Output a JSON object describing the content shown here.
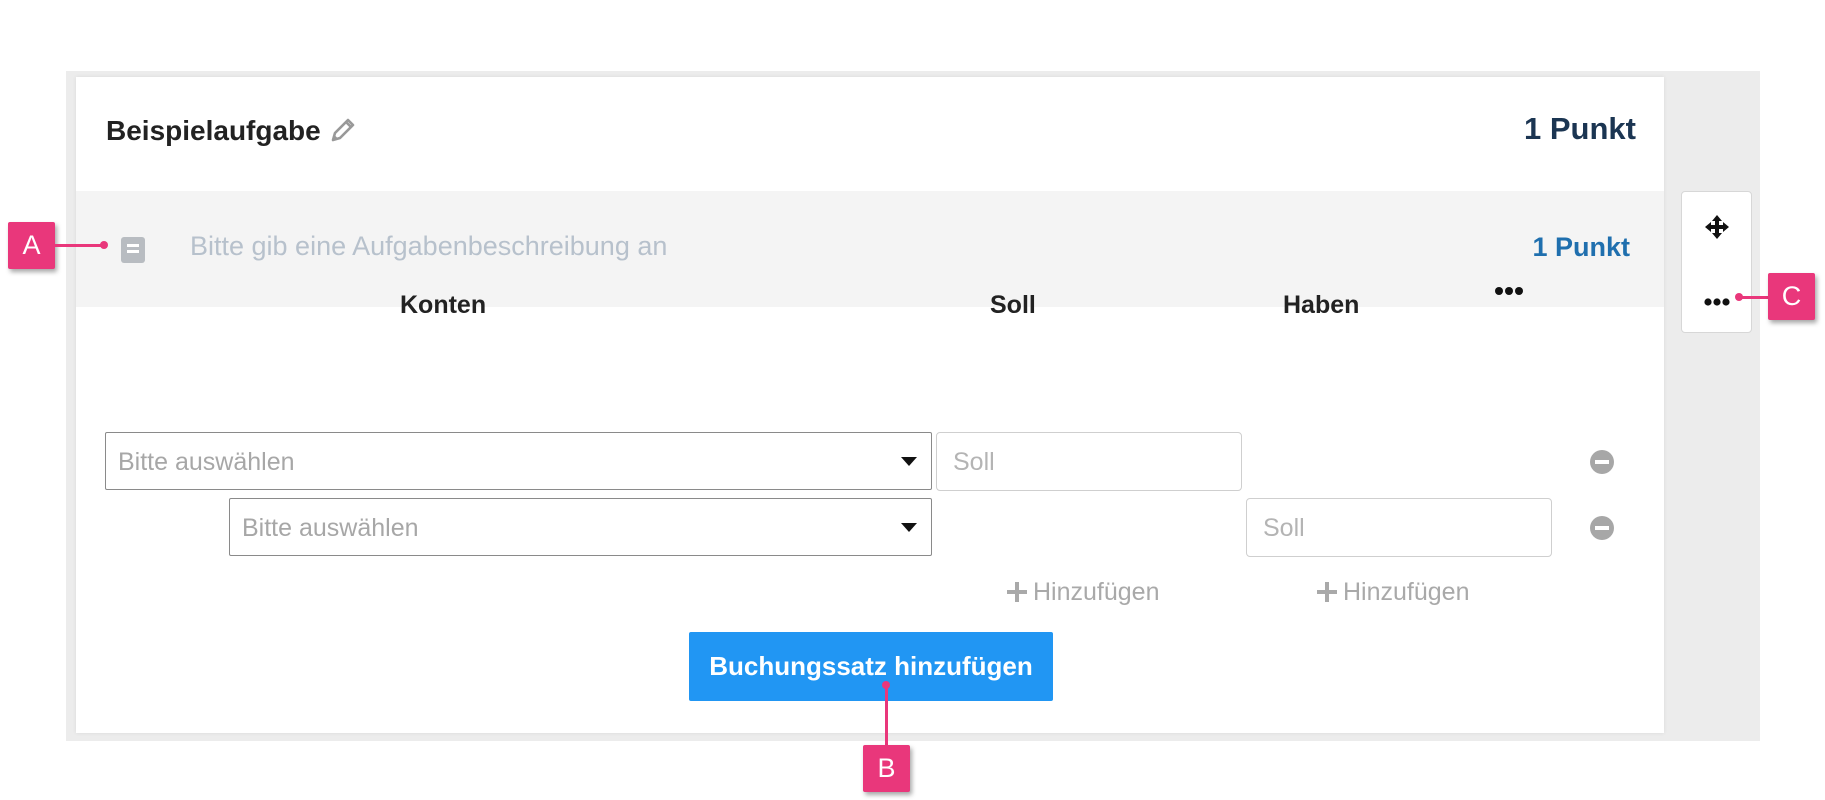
{
  "card": {
    "title": "Beispielaufgabe",
    "points_label": "1 Punkt"
  },
  "description": {
    "placeholder": "Bitte gib eine Aufgabenbeschreibung an",
    "points_label": "1 Punkt"
  },
  "table": {
    "columns": {
      "konten": "Konten",
      "soll": "Soll",
      "haben": "Haben"
    },
    "rows": [
      {
        "account_placeholder": "Bitte auswählen",
        "amount_placeholder": "Soll",
        "side": "soll"
      },
      {
        "account_placeholder": "Bitte auswählen",
        "amount_placeholder": "Soll",
        "side": "haben"
      }
    ],
    "add_soll_label": "Hinzufügen",
    "add_haben_label": "Hinzufügen"
  },
  "actions": {
    "add_booking_label": "Buchungssatz hinzufügen"
  },
  "callouts": {
    "a": "A",
    "b": "B",
    "c": "C"
  },
  "icons": {
    "edit": "pencil-icon",
    "description": "book-icon",
    "move": "move-icon",
    "more": "more-icon",
    "remove": "remove-icon",
    "add": "plus-icon"
  },
  "colors": {
    "primary": "#2196f3",
    "callout": "#e9377b",
    "header_points": "#1b3552",
    "description_points": "#1f6fae"
  }
}
